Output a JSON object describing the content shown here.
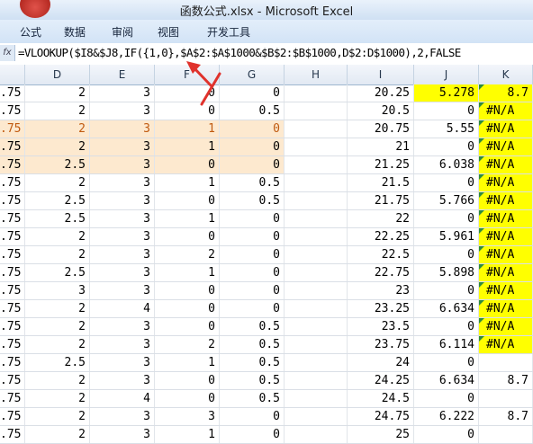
{
  "window": {
    "title": "函数公式.xlsx - Microsoft Excel"
  },
  "ribbon": {
    "tabs": [
      "公式",
      "数据",
      "审阅",
      "视图",
      "开发工具"
    ]
  },
  "formula_bar": {
    "fx_label": "fx",
    "formula": "=VLOOKUP($I8&$J8,IF({1,0},$A$2:$A$1000&$B$2:$B$1000,D$2:D$1000),2,FALSE"
  },
  "grid": {
    "columns": [
      "D",
      "E",
      "F",
      "G",
      "H",
      "I",
      "J",
      "K"
    ],
    "rows": [
      {
        "c": ".75",
        "d": "2",
        "e": "3",
        "f": "0",
        "g": "0",
        "i": "20.25",
        "j": "5.278",
        "k": "8.7"
      },
      {
        "c": ".75",
        "d": "2",
        "e": "3",
        "f": "0",
        "g": "0.5",
        "i": "20.5",
        "j": "0",
        "k": "#N/A"
      },
      {
        "c": ".75",
        "d": "2",
        "e": "3",
        "f": "1",
        "g": "0",
        "i": "20.75",
        "j": "5.55",
        "k": "#N/A"
      },
      {
        "c": ".75",
        "d": "2",
        "e": "3",
        "f": "1",
        "g": "0",
        "i": "21",
        "j": "0",
        "k": "#N/A"
      },
      {
        "c": ".75",
        "d": "2.5",
        "e": "3",
        "f": "0",
        "g": "0",
        "i": "21.25",
        "j": "6.038",
        "k": "#N/A"
      },
      {
        "c": ".75",
        "d": "2",
        "e": "3",
        "f": "1",
        "g": "0.5",
        "i": "21.5",
        "j": "0",
        "k": "#N/A"
      },
      {
        "c": ".75",
        "d": "2.5",
        "e": "3",
        "f": "0",
        "g": "0.5",
        "i": "21.75",
        "j": "5.766",
        "k": "#N/A"
      },
      {
        "c": ".75",
        "d": "2.5",
        "e": "3",
        "f": "1",
        "g": "0",
        "i": "22",
        "j": "0",
        "k": "#N/A"
      },
      {
        "c": ".75",
        "d": "2",
        "e": "3",
        "f": "0",
        "g": "0",
        "i": "22.25",
        "j": "5.961",
        "k": "#N/A"
      },
      {
        "c": ".75",
        "d": "2",
        "e": "3",
        "f": "2",
        "g": "0",
        "i": "22.5",
        "j": "0",
        "k": "#N/A"
      },
      {
        "c": ".75",
        "d": "2.5",
        "e": "3",
        "f": "1",
        "g": "0",
        "i": "22.75",
        "j": "5.898",
        "k": "#N/A"
      },
      {
        "c": ".75",
        "d": "3",
        "e": "3",
        "f": "0",
        "g": "0",
        "i": "23",
        "j": "0",
        "k": "#N/A"
      },
      {
        "c": ".75",
        "d": "2",
        "e": "4",
        "f": "0",
        "g": "0",
        "i": "23.25",
        "j": "6.634",
        "k": "#N/A"
      },
      {
        "c": ".75",
        "d": "2",
        "e": "3",
        "f": "0",
        "g": "0.5",
        "i": "23.5",
        "j": "0",
        "k": "#N/A"
      },
      {
        "c": ".75",
        "d": "2",
        "e": "3",
        "f": "2",
        "g": "0.5",
        "i": "23.75",
        "j": "6.114",
        "k": "#N/A"
      },
      {
        "c": ".75",
        "d": "2.5",
        "e": "3",
        "f": "1",
        "g": "0.5",
        "i": "24",
        "j": "0",
        "k": ""
      },
      {
        "c": ".75",
        "d": "2",
        "e": "3",
        "f": "0",
        "g": "0.5",
        "i": "24.25",
        "j": "6.634",
        "k": "8.7"
      },
      {
        "c": ".75",
        "d": "2",
        "e": "4",
        "f": "0",
        "g": "0.5",
        "i": "24.5",
        "j": "0",
        "k": ""
      },
      {
        "c": ".75",
        "d": "2",
        "e": "3",
        "f": "3",
        "g": "0",
        "i": "24.75",
        "j": "6.222",
        "k": "8.7"
      },
      {
        "c": ".75",
        "d": "2",
        "e": "3",
        "f": "1",
        "g": "0",
        "i": "25",
        "j": "0",
        "k": ""
      }
    ]
  },
  "colors": {
    "peach_highlight": "#fde9cf",
    "yellow_fill": "#ffff00",
    "orange_text": "#c05a10",
    "arrow_red": "#e0322c"
  }
}
